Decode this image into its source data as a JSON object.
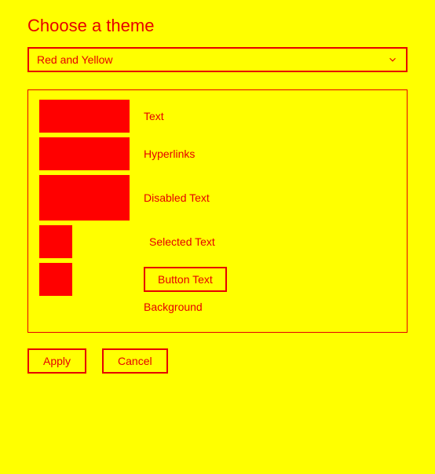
{
  "title": "Choose a theme",
  "dropdown": {
    "selected": "Red and Yellow"
  },
  "preview": {
    "text_label": "Text",
    "hyperlinks_label": "Hyperlinks",
    "disabled_label": "Disabled Text",
    "selected_label": "Selected Text",
    "button_label": "Button Text",
    "background_label": "Background"
  },
  "actions": {
    "apply": "Apply",
    "cancel": "Cancel"
  },
  "colors": {
    "accent": "#e60000",
    "swatch": "#ff0000",
    "background": "#ffff00"
  }
}
